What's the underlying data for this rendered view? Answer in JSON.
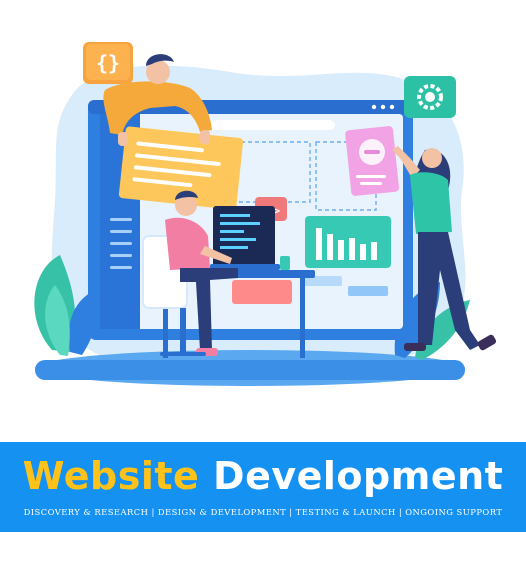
{
  "banner": {
    "title_word1": "Website",
    "title_word2": "Development",
    "subtitle": "DISCOVERY & RESEARCH | DESIGN & DEVELOPMENT | TESTING & LAUNCH | ONGOING SUPPORT"
  },
  "illustration": {
    "icons": [
      "code-braces-icon",
      "gear-icon",
      "code-tag-icon"
    ],
    "colors": {
      "blob": "#d6ebfb",
      "window": "#2f7fe0",
      "card": "#fdc75c",
      "chart": "#37c9b4",
      "banner": "#1591f2",
      "title_accent": "#ffc21a"
    }
  }
}
